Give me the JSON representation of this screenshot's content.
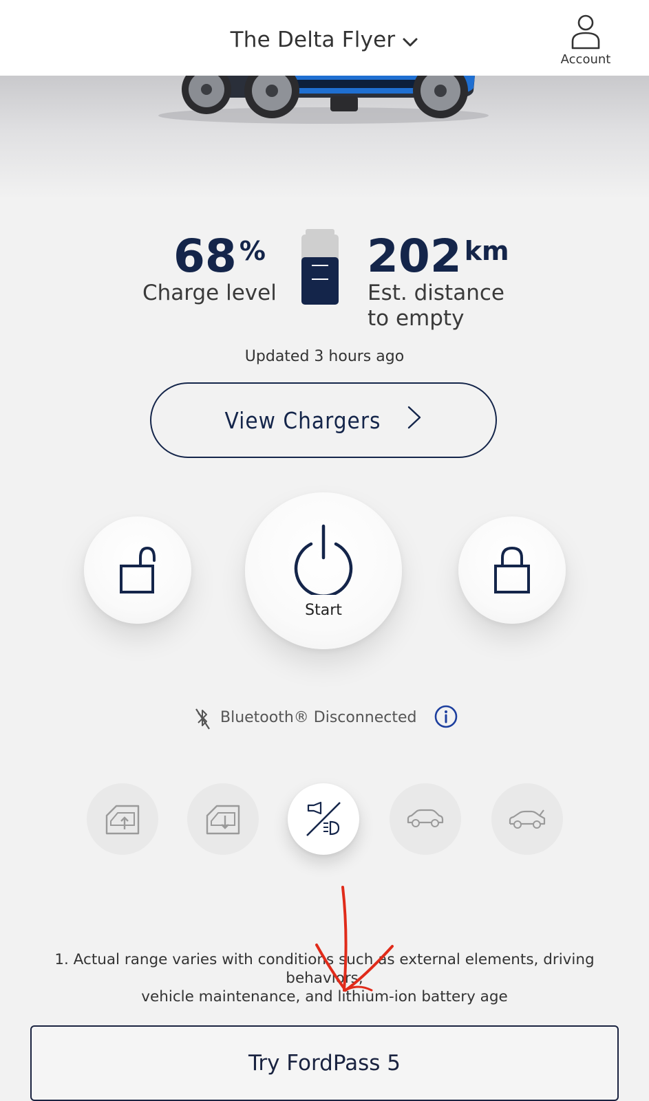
{
  "header": {
    "vehicle_name": "The Delta Flyer",
    "account_label": "Account"
  },
  "charge": {
    "percent_value": "68",
    "percent_unit": "%",
    "label": "Charge level",
    "level_fraction": 0.68
  },
  "range": {
    "value": "202",
    "unit": "km",
    "label_line1": "Est. distance",
    "label_line2": "to empty"
  },
  "updated_text": "Updated 3 hours ago",
  "view_chargers_label": "View Chargers",
  "controls": {
    "start_label": "Start"
  },
  "bluetooth": {
    "status_text": "Bluetooth® Disconnected"
  },
  "quick_actions": [
    "window-up-icon",
    "window-down-icon",
    "horn-lights-icon",
    "car-outline-icon",
    "car-trunk-icon"
  ],
  "disclaimer": {
    "line1": "1. Actual range varies with conditions such as external elements, driving behaviors,",
    "line2": "vehicle maintenance, and lithium-ion battery age"
  },
  "try_button_label": "Try FordPass 5",
  "colors": {
    "brand_navy": "#14254a",
    "background": "#f2f2f2",
    "annotation_red": "#e02b1a",
    "vehicle_blue": "#1f6fd1"
  }
}
